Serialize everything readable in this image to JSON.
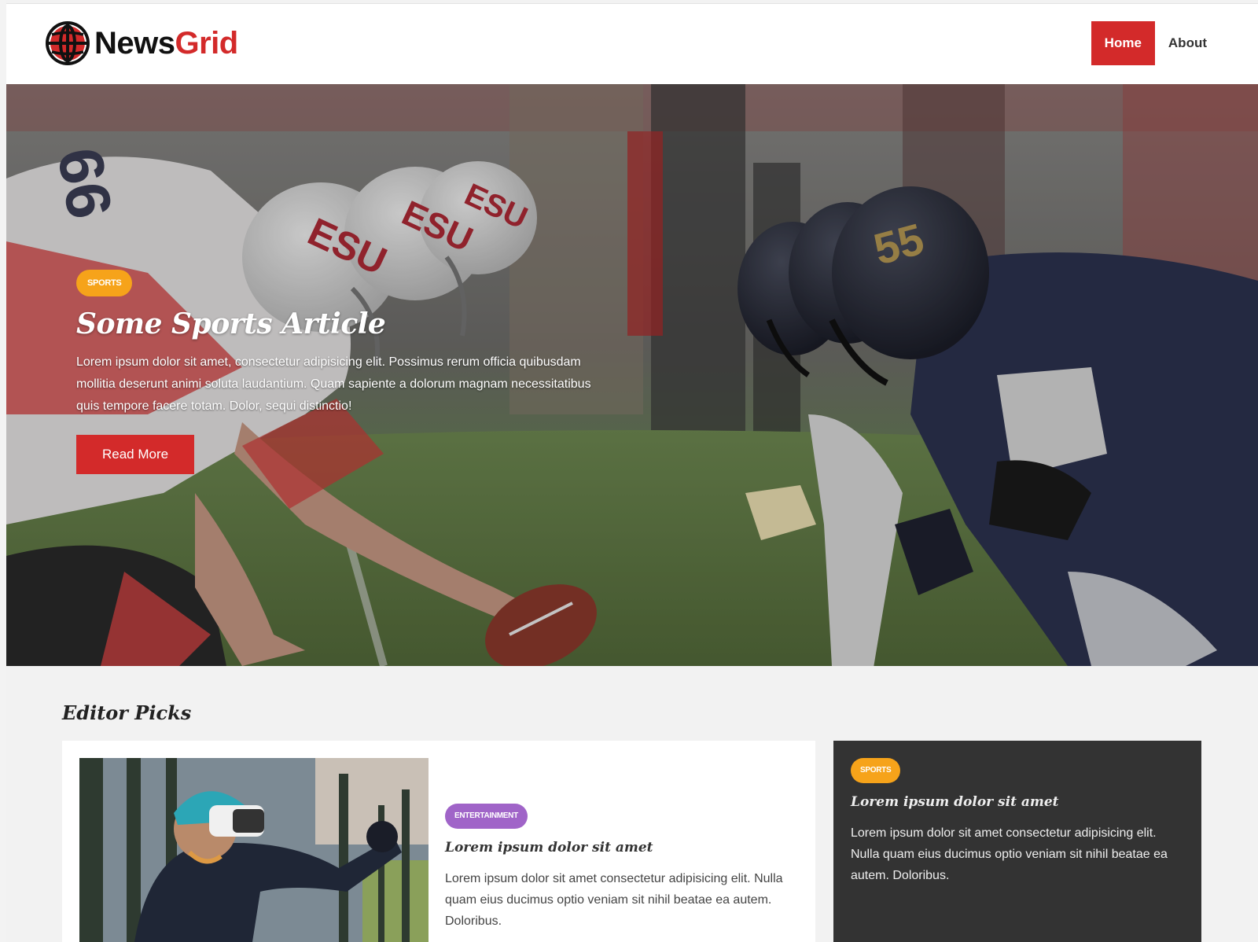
{
  "header": {
    "logo_primary": "News",
    "logo_accent": "Grid",
    "nav": [
      {
        "label": "Home",
        "active": true
      },
      {
        "label": "About",
        "active": false
      }
    ]
  },
  "hero": {
    "category": "SPORTS",
    "title": "Some Sports Article",
    "text": "Lorem ipsum dolor sit amet, consectetur adipisicing elit. Possimus rerum officia quibusdam mollitia deserunt animi soluta laudantium. Quam sapiente a dolorum magnam necessitatibus quis tempore facere totam. Dolor, sequi distinctio!",
    "button": "Read More",
    "helmet_numbers": [
      "66",
      "55"
    ],
    "helmet_text": "ESU"
  },
  "editor_picks": {
    "title": "Editor Picks",
    "main_card": {
      "category": "ENTERTAINMENT",
      "title": "Lorem ipsum dolor sit amet",
      "text": "Lorem ipsum dolor sit amet consectetur adipisicing elit. Nulla quam eius ducimus optio veniam sit nihil beatae ea autem. Doloribus."
    },
    "side_card": {
      "category": "SPORTS",
      "title": "Lorem ipsum dolor sit amet",
      "text": "Lorem ipsum dolor sit amet consectetur adipisicing elit. Nulla quam eius ducimus optio veniam sit nihil beatae ea autem. Doloribus."
    }
  },
  "colors": {
    "brand_red": "#d32a2a",
    "sports_badge": "#f6a31a",
    "entertainment_badge": "#a064c8",
    "dark_card": "#333333"
  }
}
